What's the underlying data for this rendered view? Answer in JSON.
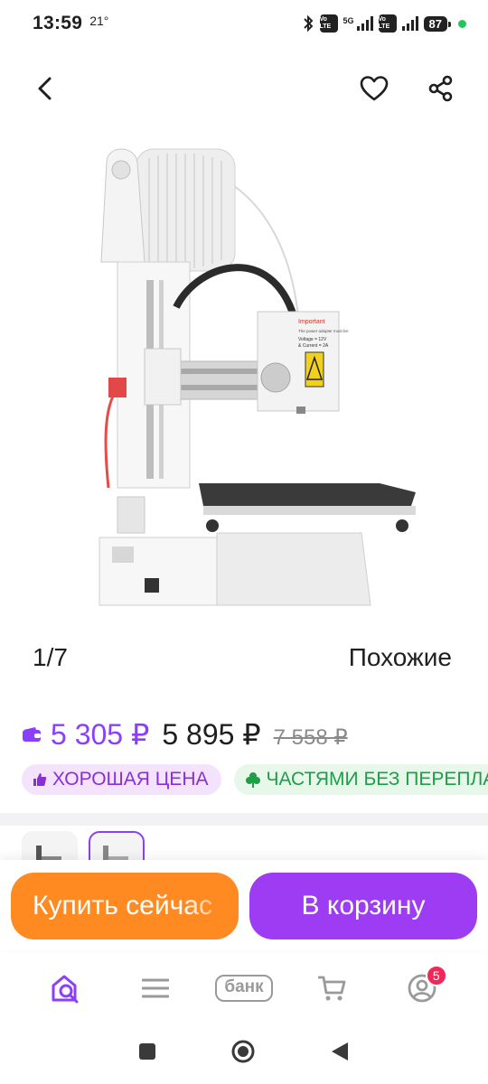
{
  "status_bar": {
    "time": "13:59",
    "temperature": "21°",
    "network_1": "5G",
    "volte_1": "Vo LTE",
    "volte_2": "Vo LTE",
    "battery": "87"
  },
  "product": {
    "image_counter": "1/7",
    "similar_link": "Похожие",
    "price_card": "5 305 ₽",
    "price": "5 895 ₽",
    "price_old": "7 558 ₽",
    "badges": [
      {
        "label": "ХОРОШАЯ ЦЕНА"
      },
      {
        "label": "ЧАСТЯМИ БЕЗ ПЕРЕПЛАТ"
      }
    ],
    "image_text": {
      "important": "Important",
      "note": "The power adapter must be:",
      "voltage": "Voltage = 12V",
      "current": "& Current = 2A"
    }
  },
  "actions": {
    "buy_now": "Купить сейчас",
    "add_to_cart": "В корзину"
  },
  "tabs": {
    "bank_label": "банк",
    "cart_count": "5"
  },
  "colors": {
    "accent": "#8b3ffc",
    "buy_button": "#ff8a22",
    "cart_button": "#9d3cf2",
    "good_price_bg": "#f3e3fd",
    "parts_bg": "#e7f7ea",
    "badge_red": "#f0285a"
  }
}
